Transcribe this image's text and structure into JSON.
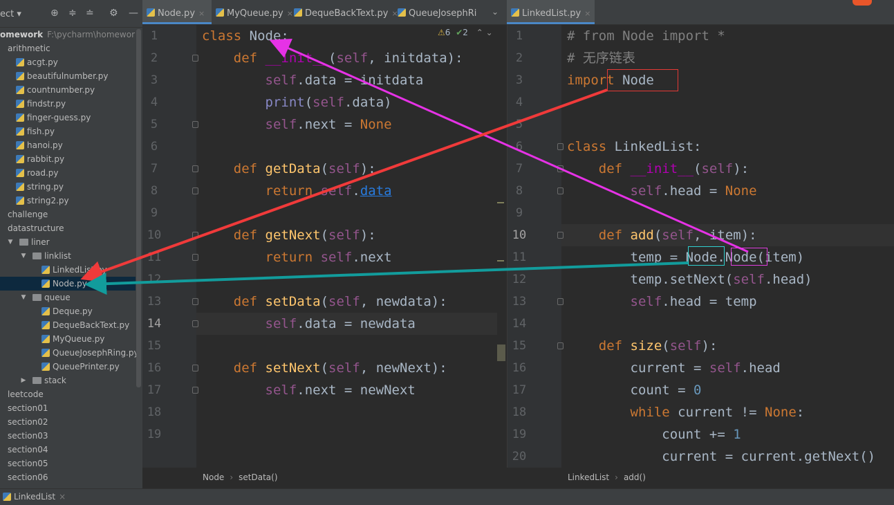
{
  "sidebar": {
    "toolbar_label": "ect",
    "root": {
      "name": "omework",
      "path": "F:\\pycharm\\homewor"
    },
    "tree": [
      {
        "label": "arithmetic",
        "type": "folder",
        "depth": 0,
        "arrow": "expanded"
      },
      {
        "label": "acgt.py",
        "type": "file",
        "depth": 1
      },
      {
        "label": "beautifulnumber.py",
        "type": "file",
        "depth": 1
      },
      {
        "label": "countnumber.py",
        "type": "file",
        "depth": 1
      },
      {
        "label": "findstr.py",
        "type": "file",
        "depth": 1
      },
      {
        "label": "finger-guess.py",
        "type": "file",
        "depth": 1
      },
      {
        "label": "fish.py",
        "type": "file",
        "depth": 1
      },
      {
        "label": "hanoi.py",
        "type": "file",
        "depth": 1
      },
      {
        "label": "rabbit.py",
        "type": "file",
        "depth": 1
      },
      {
        "label": "road.py",
        "type": "file",
        "depth": 1
      },
      {
        "label": "string.py",
        "type": "file",
        "depth": 1
      },
      {
        "label": "string2.py",
        "type": "file",
        "depth": 1
      },
      {
        "label": "challenge",
        "type": "folder",
        "depth": 0,
        "arrow": "collapsed"
      },
      {
        "label": "datastructure",
        "type": "folder",
        "depth": 0,
        "arrow": "expanded"
      },
      {
        "label": "liner",
        "type": "folder",
        "depth": 1,
        "arrow": "expanded"
      },
      {
        "label": "linklist",
        "type": "folder",
        "depth": 2,
        "arrow": "expanded"
      },
      {
        "label": "LinkedList.py",
        "type": "file",
        "depth": 3
      },
      {
        "label": "Node.py",
        "type": "file",
        "depth": 3,
        "selected": true
      },
      {
        "label": "queue",
        "type": "folder",
        "depth": 2,
        "arrow": "expanded"
      },
      {
        "label": "Deque.py",
        "type": "file",
        "depth": 3
      },
      {
        "label": "DequeBackText.py",
        "type": "file",
        "depth": 3
      },
      {
        "label": "MyQueue.py",
        "type": "file",
        "depth": 3
      },
      {
        "label": "QueueJosephRing.py",
        "type": "file",
        "depth": 3
      },
      {
        "label": "QueuePrinter.py",
        "type": "file",
        "depth": 3
      },
      {
        "label": "stack",
        "type": "folder",
        "depth": 2,
        "arrow": "collapsed"
      },
      {
        "label": "leetcode",
        "type": "folder",
        "depth": 0,
        "arrow": "collapsed"
      },
      {
        "label": "section01",
        "type": "folder",
        "depth": 0,
        "arrow": "collapsed"
      },
      {
        "label": "section02",
        "type": "folder",
        "depth": 0,
        "arrow": "collapsed"
      },
      {
        "label": "section03",
        "type": "folder",
        "depth": 0,
        "arrow": "collapsed"
      },
      {
        "label": "section04",
        "type": "folder",
        "depth": 0,
        "arrow": "collapsed"
      },
      {
        "label": "section05",
        "type": "folder",
        "depth": 0,
        "arrow": "collapsed"
      },
      {
        "label": "section06",
        "type": "folder",
        "depth": 0,
        "arrow": "collapsed"
      }
    ]
  },
  "tabs_left": [
    {
      "label": "Node.py",
      "active": true
    },
    {
      "label": "MyQueue.py"
    },
    {
      "label": "DequeBackText.py"
    },
    {
      "label": "QueueJosephRi"
    }
  ],
  "tabs_right": [
    {
      "label": "LinkedList.py",
      "active": true
    }
  ],
  "left_editor": {
    "inspection": {
      "warnings": "6",
      "typos": "2"
    },
    "current_line": 14,
    "lines": [
      [
        [
          "class ",
          "kw"
        ],
        [
          "Node",
          ""
        ],
        [
          ":",
          ""
        ]
      ],
      [
        [
          "    def ",
          "kw"
        ],
        [
          "__init__",
          "mg"
        ],
        [
          "(",
          ""
        ],
        [
          "self",
          "sf"
        ],
        [
          ", initdata):",
          ""
        ]
      ],
      [
        [
          "        ",
          ""
        ],
        [
          "self",
          "sf"
        ],
        [
          ".data = initdata",
          ""
        ]
      ],
      [
        [
          "        ",
          ""
        ],
        [
          "print",
          "bi"
        ],
        [
          "(",
          ""
        ],
        [
          "self",
          "sf"
        ],
        [
          ".data)",
          ""
        ]
      ],
      [
        [
          "        ",
          ""
        ],
        [
          "self",
          "sf"
        ],
        [
          ".next = ",
          ""
        ],
        [
          "None",
          "kw"
        ]
      ],
      [],
      [
        [
          "    def ",
          "kw"
        ],
        [
          "getData",
          "fn"
        ],
        [
          "(",
          ""
        ],
        [
          "self",
          "sf"
        ],
        [
          "):",
          ""
        ]
      ],
      [
        [
          "        return ",
          "kw"
        ],
        [
          "self",
          "sf"
        ],
        [
          ".",
          ""
        ],
        [
          "data",
          "lnk"
        ]
      ],
      [],
      [
        [
          "    def ",
          "kw"
        ],
        [
          "getNext",
          "fn"
        ],
        [
          "(",
          ""
        ],
        [
          "self",
          "sf"
        ],
        [
          "):",
          ""
        ]
      ],
      [
        [
          "        return ",
          "kw"
        ],
        [
          "self",
          "sf"
        ],
        [
          ".next",
          ""
        ]
      ],
      [],
      [
        [
          "    def ",
          "kw"
        ],
        [
          "setData",
          "fn"
        ],
        [
          "(",
          ""
        ],
        [
          "self",
          "sf"
        ],
        [
          ", newdata):",
          ""
        ]
      ],
      [
        [
          "        ",
          ""
        ],
        [
          "self",
          "sf"
        ],
        [
          ".data = newdata",
          ""
        ]
      ],
      [],
      [
        [
          "    def ",
          "kw"
        ],
        [
          "setNext",
          "fn"
        ],
        [
          "(",
          ""
        ],
        [
          "self",
          "sf"
        ],
        [
          ", newNext):",
          ""
        ]
      ],
      [
        [
          "        ",
          ""
        ],
        [
          "self",
          "sf"
        ],
        [
          ".next = newNext",
          ""
        ]
      ],
      [],
      []
    ],
    "breadcrumb": [
      "Node",
      "setData()"
    ]
  },
  "right_editor": {
    "current_line": 10,
    "lines": [
      [
        [
          "# from Node import *",
          "cm"
        ]
      ],
      [
        [
          "# 无序链表",
          "cm"
        ]
      ],
      [
        [
          "import ",
          "kw"
        ],
        [
          "Node",
          ""
        ]
      ],
      [],
      [],
      [
        [
          "class ",
          "kw"
        ],
        [
          "LinkedList:",
          ""
        ]
      ],
      [
        [
          "    def ",
          "kw"
        ],
        [
          "__init__",
          "mg"
        ],
        [
          "(",
          ""
        ],
        [
          "self",
          "sf"
        ],
        [
          "):",
          ""
        ]
      ],
      [
        [
          "        ",
          ""
        ],
        [
          "self",
          "sf"
        ],
        [
          ".head = ",
          ""
        ],
        [
          "None",
          "kw"
        ]
      ],
      [],
      [
        [
          "    def ",
          "kw"
        ],
        [
          "add",
          "fn"
        ],
        [
          "(",
          ""
        ],
        [
          "self",
          "sf"
        ],
        [
          ", item):",
          ""
        ]
      ],
      [
        [
          "        temp = Node.Node(item)",
          ""
        ]
      ],
      [
        [
          "        temp.setNext(",
          ""
        ],
        [
          "self",
          "sf"
        ],
        [
          ".head)",
          ""
        ]
      ],
      [
        [
          "        ",
          ""
        ],
        [
          "self",
          "sf"
        ],
        [
          ".head = temp",
          ""
        ]
      ],
      [],
      [
        [
          "    def ",
          "kw"
        ],
        [
          "size",
          "fn"
        ],
        [
          "(",
          ""
        ],
        [
          "self",
          "sf"
        ],
        [
          "):",
          ""
        ]
      ],
      [
        [
          "        current = ",
          ""
        ],
        [
          "self",
          "sf"
        ],
        [
          ".head",
          ""
        ]
      ],
      [
        [
          "        count = ",
          ""
        ],
        [
          "0",
          "nm"
        ]
      ],
      [
        [
          "        while ",
          "kw"
        ],
        [
          "current != ",
          ""
        ],
        [
          "None",
          "kw"
        ],
        [
          ":",
          ""
        ]
      ],
      [
        [
          "            count += ",
          ""
        ],
        [
          "1",
          "nm"
        ]
      ],
      [
        [
          "            current = current.getNext()",
          ""
        ]
      ]
    ],
    "breadcrumb": [
      "LinkedList",
      "add()"
    ]
  },
  "status": {
    "run_tab": "LinkedList"
  },
  "colors": {
    "arrow_magenta": "#e632e6",
    "arrow_red": "#f03a3a",
    "arrow_teal": "#129c9c",
    "box_red": "#e53935",
    "box_cyan": "#2fd0d0",
    "box_magenta": "#e040e0"
  }
}
